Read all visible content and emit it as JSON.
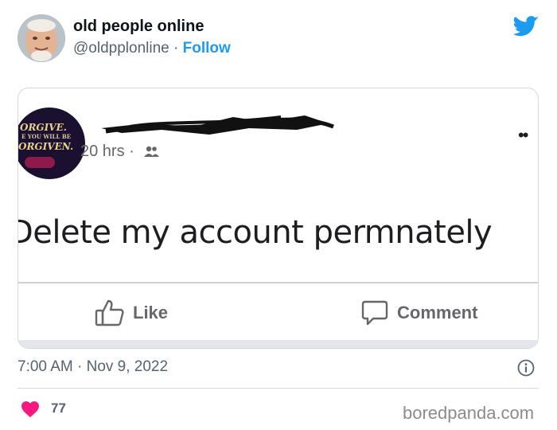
{
  "tweet": {
    "display_name": "old people online",
    "handle": "@oldpplonline",
    "separator": "·",
    "follow_label": "Follow",
    "timestamp": "7:00 AM · Nov 9, 2022",
    "like_count": "77",
    "brand_color": "#1d9bf0",
    "like_color": "#f91880"
  },
  "facebook_post": {
    "avatar_text": [
      "ORGIVE.",
      "E YOU WILL BE",
      "ORGIVEN."
    ],
    "time": "20 hrs",
    "separator": "·",
    "audience_icon": "friends-icon",
    "more_icon": "••",
    "post_text": "Delete my account permnately",
    "like_label": "Like",
    "comment_label": "Comment"
  },
  "watermark": "boredpanda.com"
}
